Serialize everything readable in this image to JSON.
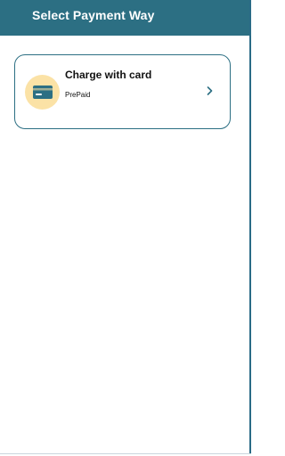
{
  "app_bar": {
    "title": "Select Payment Way"
  },
  "payment_options": [
    {
      "title": "Charge with card",
      "subtitle": "PrePaid",
      "icon": "credit-card-icon",
      "chevron_icon": "chevron-right-icon"
    }
  ],
  "colors": {
    "primary": "#2c6f83",
    "icon_bg": "#fbe2a6",
    "text": "#111111",
    "background": "#ffffff"
  }
}
